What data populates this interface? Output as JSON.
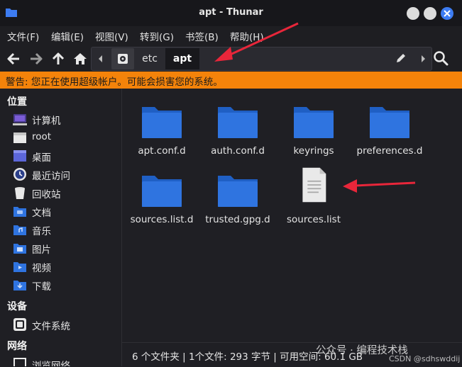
{
  "window": {
    "title": "apt - Thunar"
  },
  "menu": [
    "文件(F)",
    "编辑(E)",
    "视图(V)",
    "转到(G)",
    "书签(B)",
    "帮助(H)"
  ],
  "path": [
    "etc",
    "apt"
  ],
  "warning": "警告: 您正在使用超级帐户。可能会损害您的系统。",
  "sidebar": {
    "places_heading": "位置",
    "places": [
      {
        "label": "计算机",
        "icon": "computer-icon"
      },
      {
        "label": "root",
        "icon": "home-folder-icon"
      },
      {
        "label": "桌面",
        "icon": "desktop-icon"
      },
      {
        "label": "最近访问",
        "icon": "recent-icon"
      },
      {
        "label": "回收站",
        "icon": "trash-icon"
      },
      {
        "label": "文档",
        "icon": "documents-folder-icon"
      },
      {
        "label": "音乐",
        "icon": "music-folder-icon"
      },
      {
        "label": "图片",
        "icon": "pictures-folder-icon"
      },
      {
        "label": "视频",
        "icon": "videos-folder-icon"
      },
      {
        "label": "下载",
        "icon": "downloads-folder-icon"
      }
    ],
    "devices_heading": "设备",
    "devices": [
      {
        "label": "文件系统",
        "icon": "filesystem-icon"
      }
    ],
    "network_heading": "网络",
    "network": [
      {
        "label": "浏览网络",
        "icon": "network-icon"
      }
    ]
  },
  "files": [
    {
      "name": "apt.conf.d",
      "type": "folder"
    },
    {
      "name": "auth.conf.d",
      "type": "folder"
    },
    {
      "name": "keyrings",
      "type": "folder"
    },
    {
      "name": "preferences.d",
      "type": "folder"
    },
    {
      "name": "sources.list.d",
      "type": "folder"
    },
    {
      "name": "trusted.gpg.d",
      "type": "folder"
    },
    {
      "name": "sources.list",
      "type": "file"
    }
  ],
  "status": "6 个文件夹 | 1个文件: 293 字节 | 可用空间: 60.1 GB",
  "watermark": {
    "line1": "公众号 · 编程技术栈",
    "line2": "CSDN @sdhswddij"
  },
  "colors": {
    "accent": "#3d7cf2",
    "folder": "#2f74e0",
    "warning": "#f4830a",
    "annotation": "#e8263a"
  }
}
